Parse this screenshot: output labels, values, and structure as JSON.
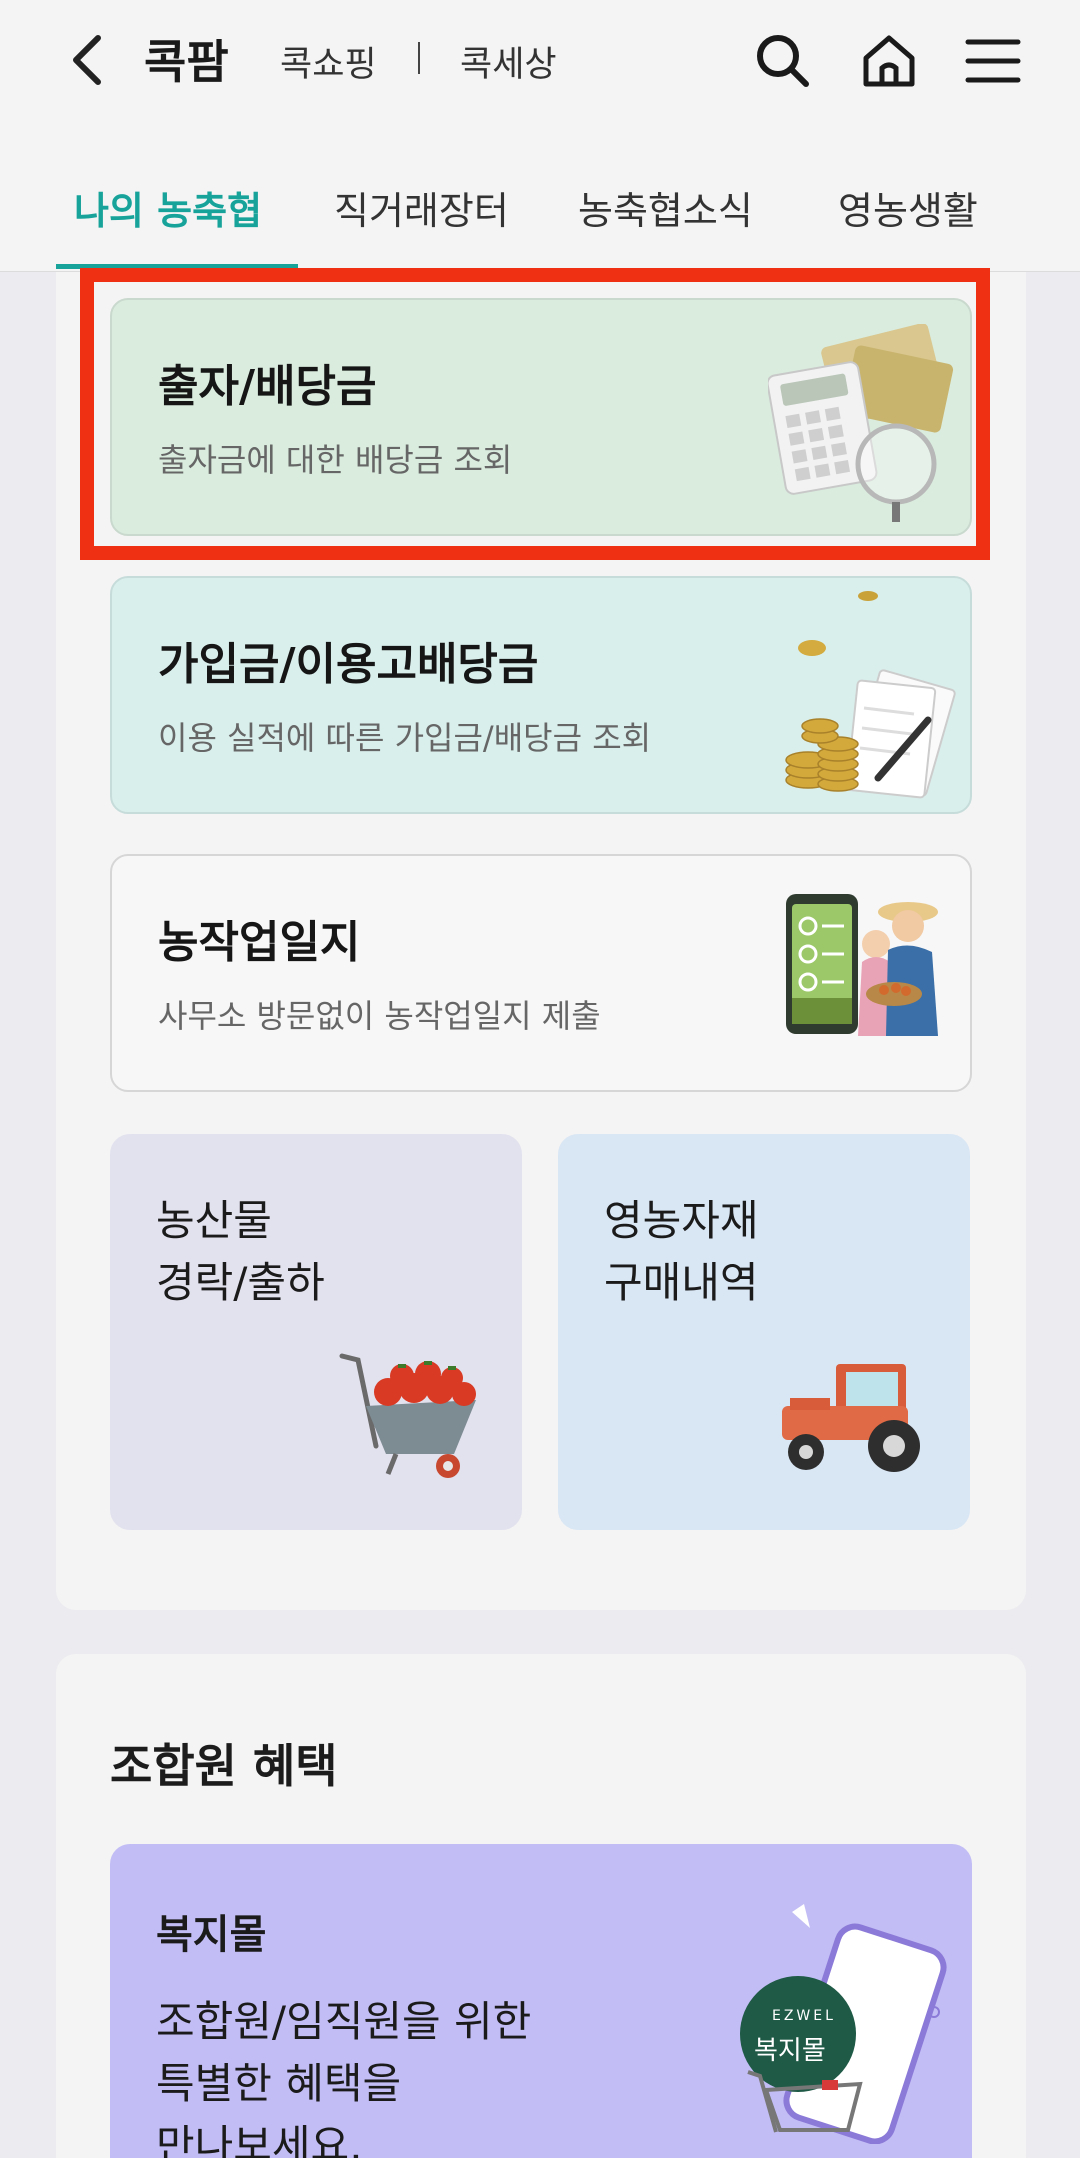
{
  "header": {
    "brand": "콕팜",
    "link_shopping": "콕쇼핑",
    "link_world": "콕세상"
  },
  "tabs": [
    {
      "label": "나의 농축협",
      "active": true
    },
    {
      "label": "직거래장터",
      "active": false
    },
    {
      "label": "농축협소식",
      "active": false
    },
    {
      "label": "영농생활",
      "active": false
    }
  ],
  "cards": {
    "dividend": {
      "title": "출자/배당금",
      "desc": "출자금에 대한 배당금 조회",
      "icon": "calculator-money-icon"
    },
    "usage": {
      "title": "가입금/이용고배당금",
      "desc": "이용 실적에 따른 가입금/배당금 조회",
      "icon": "coins-documents-icon"
    },
    "diary": {
      "title": "농작업일지",
      "desc": "사무소 방문없이 농작업일지 제출",
      "icon": "farmers-phone-icon"
    },
    "auction": {
      "line1": "농산물",
      "line2": "경락/출하",
      "icon": "tomato-cart-icon"
    },
    "supplies": {
      "line1": "영농자재",
      "line2": "구매내역",
      "icon": "tractor-icon"
    }
  },
  "benefits": {
    "section_title": "조합원 혜택",
    "welfare": {
      "title": "복지몰",
      "line1": "조합원/임직원을 위한",
      "line2": "특별한 혜택을",
      "line3": "만나보세요.",
      "badge_top": "EZWEL",
      "badge_main": "복지몰"
    }
  },
  "colors": {
    "accent": "#17a29a",
    "highlight": "#f03012"
  }
}
